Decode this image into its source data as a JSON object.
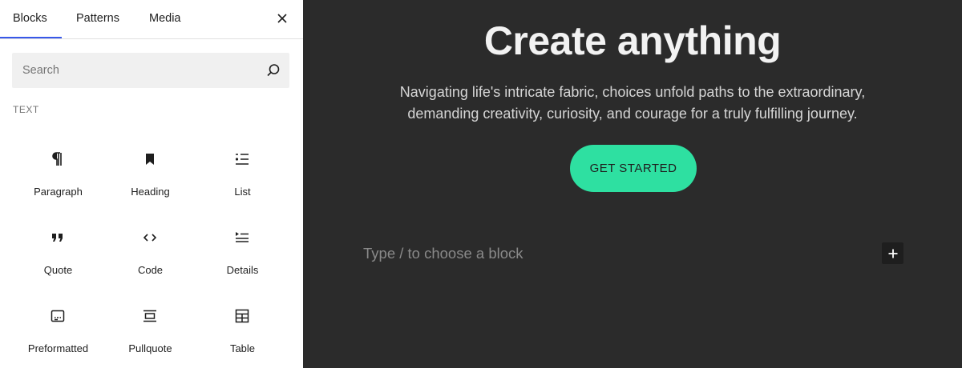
{
  "sidebar": {
    "tabs": [
      {
        "label": "Blocks",
        "active": true
      },
      {
        "label": "Patterns",
        "active": false
      },
      {
        "label": "Media",
        "active": false
      }
    ],
    "search": {
      "placeholder": "Search"
    },
    "section_label": "TEXT",
    "blocks": [
      {
        "label": "Paragraph",
        "icon": "paragraph-icon"
      },
      {
        "label": "Heading",
        "icon": "heading-icon"
      },
      {
        "label": "List",
        "icon": "list-icon"
      },
      {
        "label": "Quote",
        "icon": "quote-icon"
      },
      {
        "label": "Code",
        "icon": "code-icon"
      },
      {
        "label": "Details",
        "icon": "details-icon"
      },
      {
        "label": "Preformatted",
        "icon": "preformatted-icon"
      },
      {
        "label": "Pullquote",
        "icon": "pullquote-icon"
      },
      {
        "label": "Table",
        "icon": "table-icon"
      }
    ],
    "accent_color": "#3858e9"
  },
  "canvas": {
    "title": "Create anything",
    "text_line1": "Navigating life's intricate fabric, choices unfold paths to the extraordinary,",
    "text_line2": "demanding creativity, curiosity, and courage for a truly fulfilling journey.",
    "cta_label": "GET STARTED",
    "cta_color": "#2ee0a1",
    "block_placeholder": "Type / to choose a block",
    "background_color": "#2b2b2b"
  }
}
